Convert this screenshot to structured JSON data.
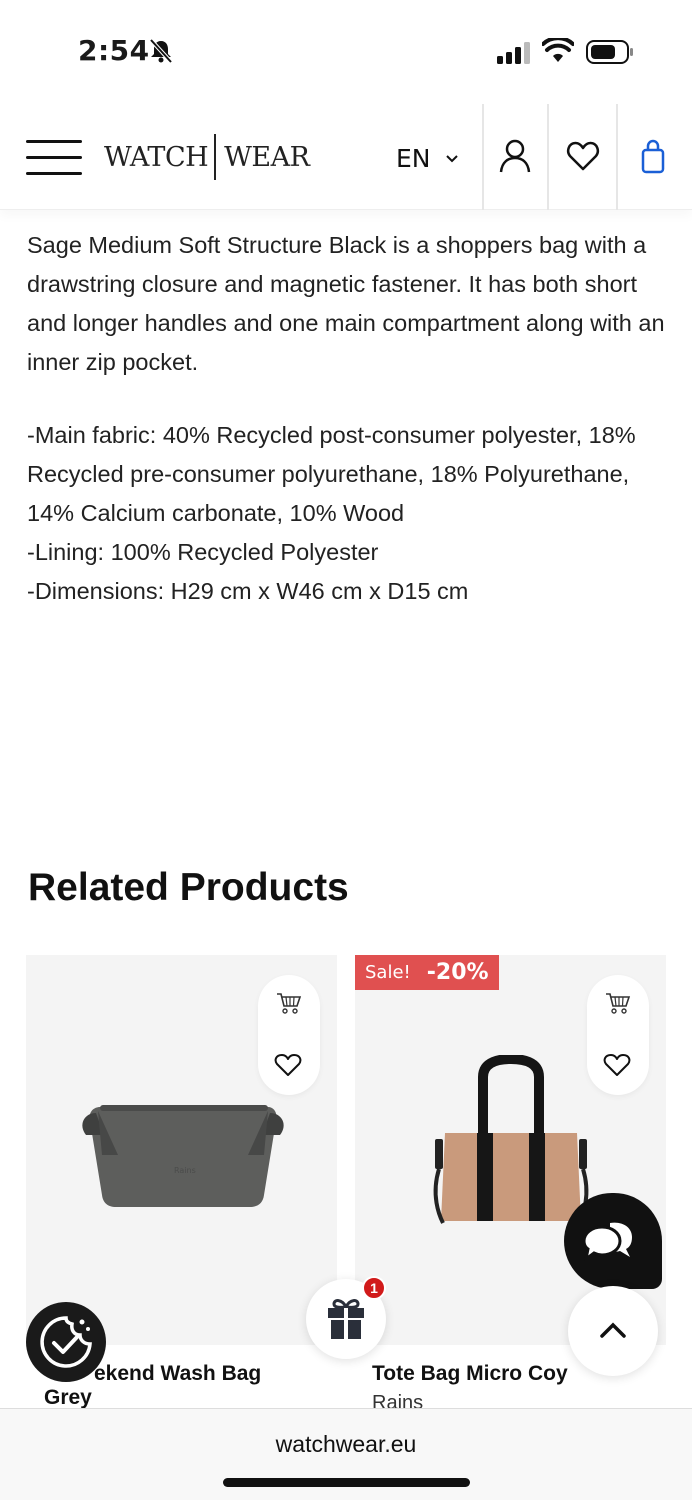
{
  "status_bar": {
    "time": "2:54"
  },
  "header": {
    "logo_left": "WATCH",
    "logo_right": "WEAR",
    "language": "EN"
  },
  "description": {
    "paragraph": "Sage Medium Soft Structure Black is a shoppers bag with a drawstring closure and magnetic fastener. It has both short and longer handles and one main compartment along with an inner zip pocket.",
    "specs": [
      "-Main fabric: 40% Recycled post-consumer polyester, 18% Recycled pre-consumer polyurethane, 18% Polyurethane, 14% Calcium carbonate, 10% Wood",
      "-Lining: 100% Recycled Polyester",
      "-Dimensions: H29 cm x W46 cm x D15 cm"
    ]
  },
  "related": {
    "title": "Related Products",
    "products": [
      {
        "name": "Weekend Wash Bag Grey",
        "name_visible": "ekend Wash Bag",
        "name_line2": "Grey"
      },
      {
        "name": "Tote Bag Micro Coy",
        "brand": "Rains",
        "sale_label": "Sale!",
        "discount": "-20%"
      }
    ]
  },
  "widgets": {
    "gift_count": "1"
  },
  "browser": {
    "url": "watchwear.eu"
  },
  "colors": {
    "sale": "#e05050",
    "accent_bag": "#1a5fd6",
    "badge": "#d11a1a"
  }
}
